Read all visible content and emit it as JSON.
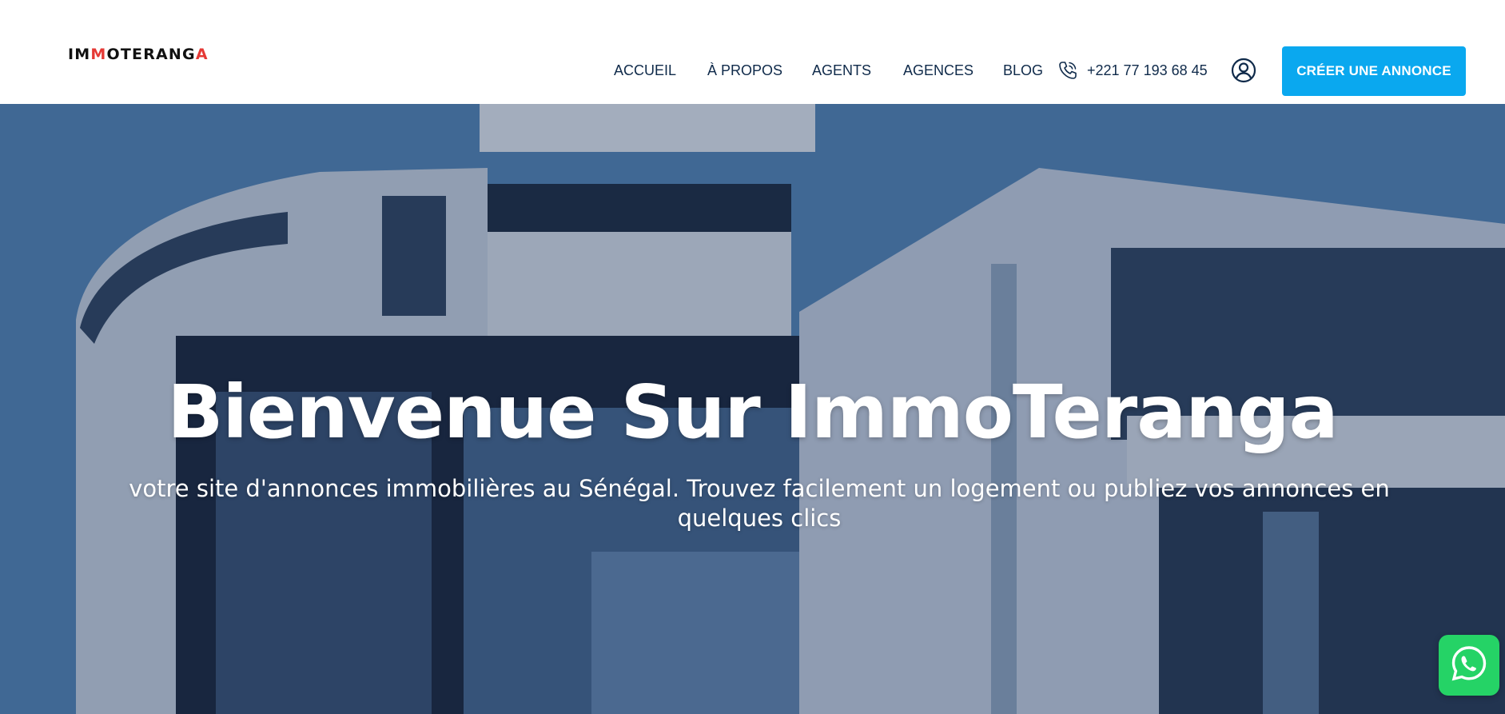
{
  "header": {
    "logo": {
      "part1": "IM",
      "accent1": "M",
      "part2": "OTERANG",
      "accent2": "A"
    },
    "nav": [
      {
        "label": "ACCUEIL"
      },
      {
        "label": "À PROPOS"
      },
      {
        "label": "AGENTS"
      },
      {
        "label": "AGENCES"
      },
      {
        "label": "BLOG"
      }
    ],
    "phone": {
      "icon": "phone-icon",
      "number": "+221 77 193 68 45"
    },
    "user_icon": "user-circle-icon",
    "cta_label": "CRÉER UNE ANNONCE"
  },
  "hero": {
    "title": "Bienvenue Sur ImmoTeranga",
    "subtitle": "votre site d'annonces immobilières au Sénégal. Trouvez facilement un logement ou publiez vos annonces en quelques clics"
  },
  "floating": {
    "whatsapp_icon": "whatsapp-icon"
  },
  "colors": {
    "accent": "#0aa8ef",
    "logo_accent": "#e53935",
    "nav_text": "#0f2a4a",
    "whatsapp": "#25d366"
  }
}
